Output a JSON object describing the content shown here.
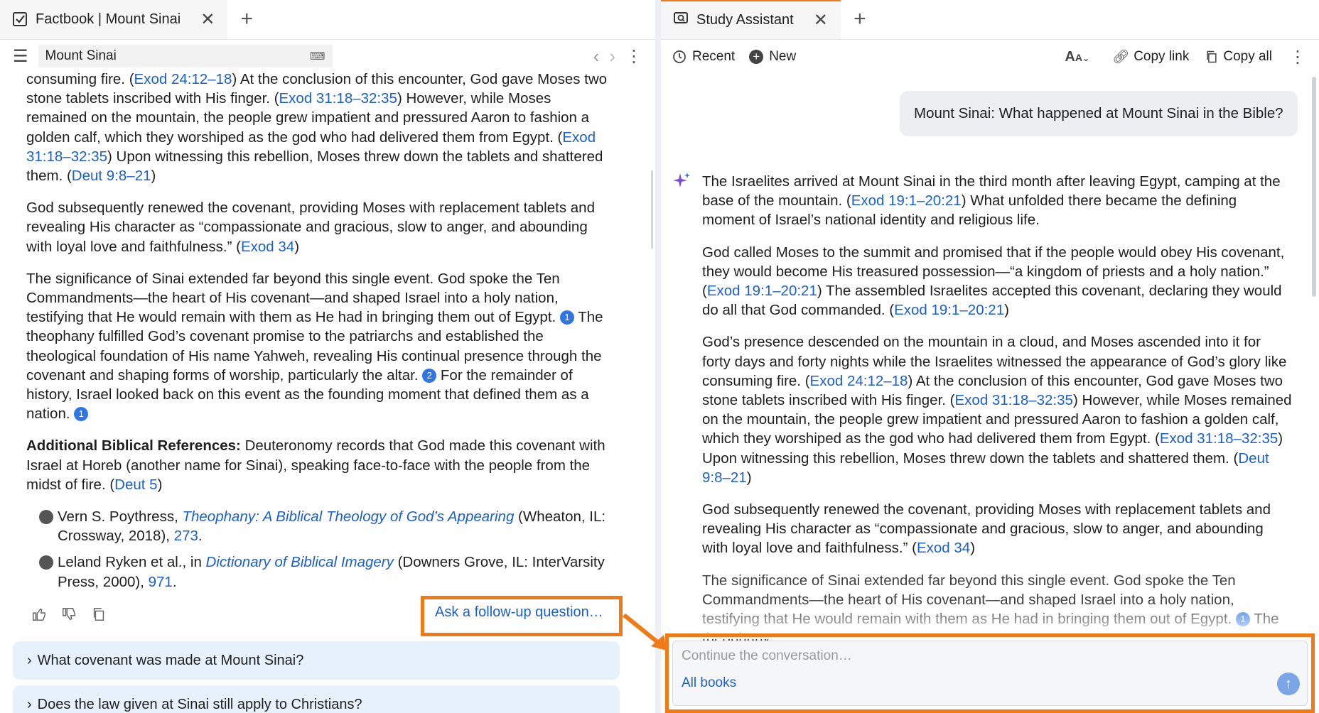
{
  "left": {
    "tab_title": "Factbook | Mount Sinai",
    "search_value": "Mount Sinai",
    "para1": [
      {
        "t": "consuming fire. ("
      },
      {
        "r": "Exod 24:12–18"
      },
      {
        "t": ") At the conclusion of this encounter, God gave Moses two stone tablets inscribed with His finger. ("
      },
      {
        "r": "Exod 31:18–32:35"
      },
      {
        "t": ") However, while Moses remained on the mountain, the people grew impatient and pressured Aaron to fashion a golden calf, which they worshiped as the god who had delivered them from Egypt. ("
      },
      {
        "r": "Exod 31:18–32:35"
      },
      {
        "t": ") Upon witnessing this rebellion, Moses threw down the tablets and shattered them. ("
      },
      {
        "r": "Deut 9:8–21"
      },
      {
        "t": ")"
      }
    ],
    "para2": [
      {
        "t": "God subsequently renewed the covenant, providing Moses with replacement tablets and revealing His character as “compassionate and gracious, slow to anger, and abounding with loyal love and faithfulness.” ("
      },
      {
        "r": "Exod 34"
      },
      {
        "t": ")"
      }
    ],
    "para3": [
      {
        "t": "The significance of Sinai extended far beyond this single event. God spoke the Ten Commandments—the heart of His covenant—and shaped Israel into a holy nation, testifying that He would remain with them as He had in bringing them out of Egypt. "
      },
      {
        "c": "1"
      },
      {
        "t": " The theophany fulfilled God’s covenant promise to the patriarchs and established the theological foundation of His name Yahweh, revealing His continual presence through the covenant and shaping forms of worship, particularly the altar. "
      },
      {
        "c": "2"
      },
      {
        "t": " For the remainder of history, Israel looked back on this event as the founding moment that defined them as a nation. "
      },
      {
        "c": "1"
      }
    ],
    "para4_bold": "Additional Biblical References:",
    "para4": [
      {
        "t": " Deuteronomy records that God made this covenant with Israel at Horeb (another name for Sinai), speaking face-to-face with the people from the midst of fire. ("
      },
      {
        "r": "Deut 5"
      },
      {
        "t": ")"
      }
    ],
    "footnotes": [
      {
        "num": "1",
        "author": "Vern S. Poythress, ",
        "title": "Theophany: A Biblical Theology of God’s Appearing",
        "pub": " (Wheaton, IL: Crossway, 2018), ",
        "page": "273",
        "end": "."
      },
      {
        "num": "2",
        "author": "Leland Ryken et al., in ",
        "title": "Dictionary of Biblical Imagery",
        "pub": " (Downers Grove, IL: InterVarsity Press, 2000), ",
        "page": "971",
        "end": "."
      }
    ],
    "followup": "Ask a follow-up question…",
    "suggestions": [
      "What covenant was made at Mount Sinai?",
      "Does the law given at Sinai still apply to Christians?"
    ]
  },
  "right": {
    "tab_title": "Study Assistant",
    "recent": "Recent",
    "new": "New",
    "copy_link": "Copy link",
    "copy_all": "Copy all",
    "question": "Mount Sinai: What happened at Mount Sinai in the Bible?",
    "para1": [
      {
        "t": "The Israelites arrived at Mount Sinai in the third month after leaving Egypt, camping at the base of the mountain. ("
      },
      {
        "r": "Exod 19:1–20:21"
      },
      {
        "t": ") What unfolded there became the defining moment of Israel’s national identity and religious life."
      }
    ],
    "para2": [
      {
        "t": "God called Moses to the summit and promised that if the people would obey His covenant, they would become His treasured possession—“a kingdom of priests and a holy nation.” ("
      },
      {
        "r": "Exod 19:1–20:21"
      },
      {
        "t": ") The assembled Israelites accepted this covenant, declaring they would do all that God commanded. ("
      },
      {
        "r": "Exod 19:1–20:21"
      },
      {
        "t": ")"
      }
    ],
    "para3": [
      {
        "t": "God’s presence descended on the mountain in a cloud, and Moses ascended into it for forty days and forty nights while the Israelites witnessed the appearance of God’s glory like consuming fire. ("
      },
      {
        "r": "Exod 24:12–18"
      },
      {
        "t": ") At the conclusion of this encounter, God gave Moses two stone tablets inscribed with His finger. ("
      },
      {
        "r": "Exod 31:18–32:35"
      },
      {
        "t": ") However, while Moses remained on the mountain, the people grew impatient and pressured Aaron to fashion a golden calf, which they worshiped as the god who had delivered them from Egypt. ("
      },
      {
        "r": "Exod 31:18–32:35"
      },
      {
        "t": ") Upon witnessing this rebellion, Moses threw down the tablets and shattered them. ("
      },
      {
        "r": "Deut 9:8–21"
      },
      {
        "t": ")"
      }
    ],
    "para4": [
      {
        "t": "God subsequently renewed the covenant, providing Moses with replacement tablets and revealing His character as “compassionate and gracious, slow to anger, and abounding with loyal love and faithfulness.” ("
      },
      {
        "r": "Exod 34"
      },
      {
        "t": ")"
      }
    ],
    "para5": [
      {
        "t": "The significance of Sinai extended far beyond this single event. God spoke the Ten Commandments—the heart of His covenant—and shaped Israel into a holy nation, testifying that He would remain with them as He had in bringing them out of Egypt. "
      },
      {
        "c": "1"
      },
      {
        "t": " The theophany"
      }
    ],
    "input_placeholder": "Continue the conversation…",
    "scope": "All books"
  },
  "colors": {
    "accent_orange": "#f07b16",
    "link_blue": "#1a5fd0",
    "cite_blue": "#2f76e3"
  }
}
